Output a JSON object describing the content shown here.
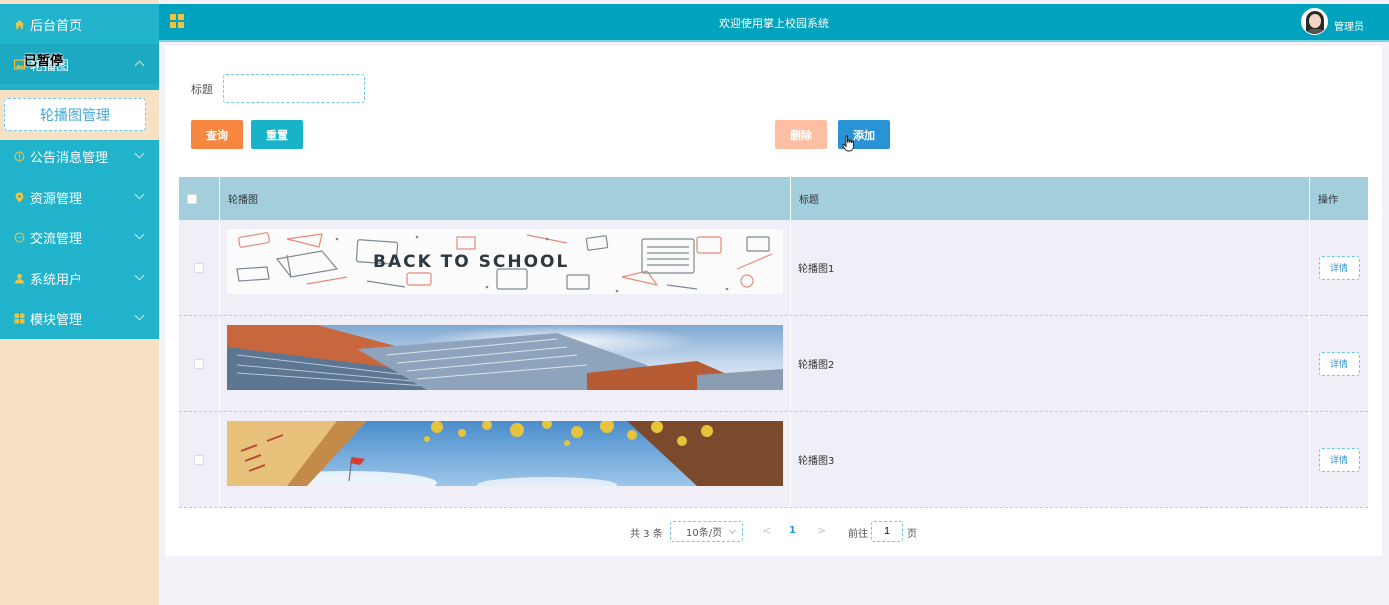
{
  "sidebar": {
    "home": {
      "label": "后台首页",
      "icon": "home-icon"
    },
    "carousel": {
      "label": "轮播图",
      "icon": "image-icon",
      "expanded": true,
      "sub_items": [
        {
          "label": "轮播图管理"
        }
      ]
    },
    "items": [
      {
        "label": "公告消息管理",
        "icon": "info-icon"
      },
      {
        "label": "资源管理",
        "icon": "location-pin-icon"
      },
      {
        "label": "交流管理",
        "icon": "chat-icon"
      },
      {
        "label": "系统用户",
        "icon": "user-icon"
      },
      {
        "label": "模块管理",
        "icon": "grid-icon"
      }
    ],
    "overlay_text": "已暂停"
  },
  "header": {
    "title": "欢迎使用掌上校园系统",
    "user": "管理员"
  },
  "search": {
    "label": "标题",
    "value": "",
    "query_label": "查询",
    "reset_label": "重置"
  },
  "actions": {
    "delete_label": "删除",
    "add_label": "添加"
  },
  "table": {
    "columns": [
      "轮播图",
      "标题",
      "操作"
    ],
    "rows": [
      {
        "title": "轮播图1",
        "image_text": "BACK TO SCHOOL",
        "detail": "详情"
      },
      {
        "title": "轮播图2",
        "detail": "详情"
      },
      {
        "title": "轮播图3",
        "detail": "详情"
      }
    ]
  },
  "pagination": {
    "total": "共 3 条",
    "page_size": "10条/页",
    "current_page": "1",
    "goto_label": "前往",
    "goto_value": "1",
    "page_label": "页"
  },
  "colors": {
    "menu": "#21b2cc",
    "header": "#00a3bd",
    "sidebar_bg": "#f6e1c5",
    "query": "#f7873f",
    "reset": "#19b3c9",
    "delete": "#fdbea1",
    "add": "#2a93d5",
    "table_header": "#a2cfdb"
  }
}
